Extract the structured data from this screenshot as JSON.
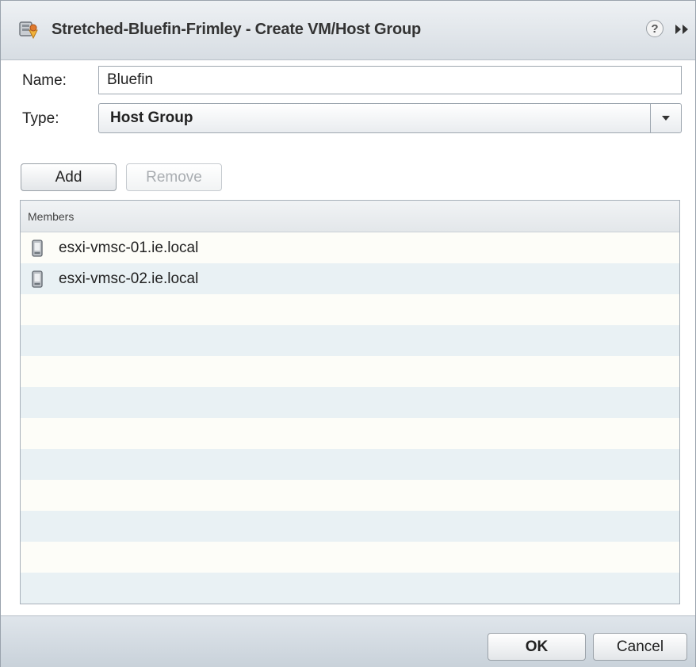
{
  "dialog": {
    "title": "Stretched-Bluefin-Frimley - Create VM/Host Group",
    "title_icon": "cluster-group-icon",
    "help_icon": "help-icon",
    "expand_icon": "double-chevron-right-icon"
  },
  "form": {
    "name_label": "Name:",
    "name_value": "Bluefin",
    "type_label": "Type:",
    "type_value": "Host Group"
  },
  "actions": {
    "add_label": "Add",
    "remove_label": "Remove"
  },
  "members": {
    "header": "Members",
    "items": [
      {
        "name": "esxi-vmsc-01.ie.local",
        "icon": "host-server-icon"
      },
      {
        "name": "esxi-vmsc-02.ie.local",
        "icon": "host-server-icon"
      }
    ]
  },
  "footer": {
    "ok_label": "OK",
    "cancel_label": "Cancel"
  },
  "colors": {
    "row_even": "#e9f1f4",
    "row_odd": "#fdfdf8",
    "titlebar": "#dfe4e9"
  }
}
